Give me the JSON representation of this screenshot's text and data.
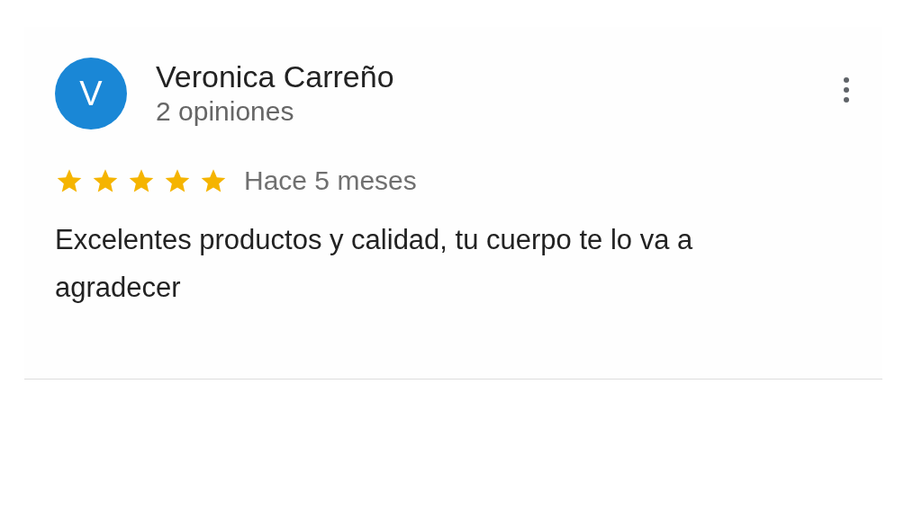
{
  "review": {
    "avatar_letter": "V",
    "author": "Veronica Carreño",
    "author_reviews": "2 opiniones",
    "stars": 5,
    "time": "Hace 5 meses",
    "text": "Excelentes productos y calidad, tu cuerpo te lo va a agradecer"
  }
}
